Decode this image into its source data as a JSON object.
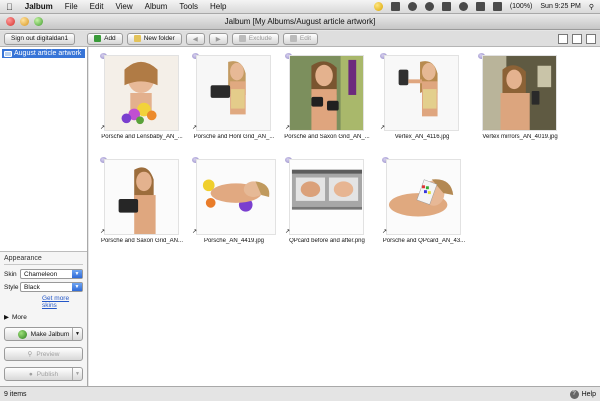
{
  "menubar": {
    "apple": "",
    "app_name": "Jalbum",
    "items": [
      "File",
      "Edit",
      "View",
      "Album",
      "Tools",
      "Help"
    ],
    "battery": "(100%)",
    "clock": "Sun 9:25 PM"
  },
  "window": {
    "title": "Jalbum [My Albums/August article artwork]"
  },
  "toolbar": {
    "sign_out": "Sign out digitaldan1",
    "add": "Add",
    "new_folder": "New folder",
    "exclude": "Exclude",
    "edit": "Edit"
  },
  "sidebar": {
    "tree_item": "August article artwork",
    "appearance_label": "Appearance",
    "skin_label": "Skin",
    "skin_value": "Chameleon",
    "style_label": "Style",
    "style_value": "Black",
    "get_more_skins": "Get more skins",
    "more_label": "More",
    "make_album": "Make Jalbum",
    "preview": "Preview",
    "publish": "Publish"
  },
  "thumbnails": [
    {
      "caption": "Porsche and Lensbaby_AN_..."
    },
    {
      "caption": "Porsche and Honl Grid_AN_..."
    },
    {
      "caption": "Porsche and Saxon Grid_AN_..."
    },
    {
      "caption": "Vertex_AN_4116.jpg"
    },
    {
      "caption": "Vertex mirrors_AN_4019.jpg"
    },
    {
      "caption": "Porsche and Saxon Grid_AN..."
    },
    {
      "caption": "Porsche_AN_4419.jpg"
    },
    {
      "caption": "QPcard before and after.png"
    },
    {
      "caption": "Porsche and QPcard_AN_43..."
    }
  ],
  "status": {
    "items_count": "9 items",
    "help": "Help"
  }
}
